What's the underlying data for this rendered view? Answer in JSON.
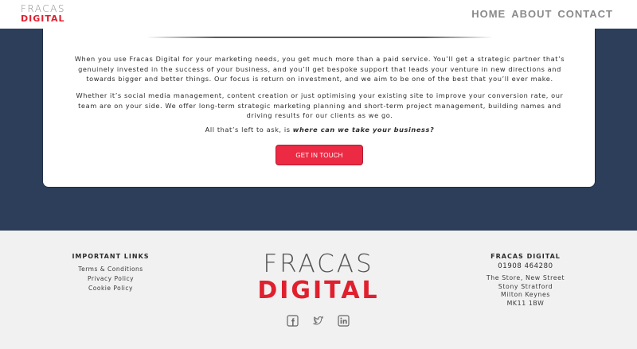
{
  "header": {
    "logo_top": "FRACAS",
    "logo_bottom": "DIGITAL",
    "nav": [
      "HOME",
      "ABOUT",
      "CONTACT"
    ]
  },
  "main": {
    "paragraph1": "When you use Fracas Digital for your marketing needs, you get much more than a paid service. You’ll get a strategic partner that’s genuinely invested in the success of your business, and you’ll get bespoke support that leads your venture in new directions and towards bigger and better things. Our focus is return on investment, and we aim to be one of the best that you’ll ever make.",
    "paragraph2": "Whether it’s social media management, content creation or just optimising your existing site to improve your conversion rate, our team are on your side. We offer long-term strategic marketing planning and short-term project management, building names and driving results for our clients as we go.",
    "closing_prefix": "All that’s left to ask, is ",
    "closing_emphasis": "where can we take your business?",
    "cta_label": "GET IN TOUCH"
  },
  "footer": {
    "links_title": "IMPORTANT LINKS",
    "links": [
      "Terms & Conditions",
      "Privacy Policy",
      "Cookie Policy"
    ],
    "logo_top": "FRACAS",
    "logo_bottom": "DIGITAL",
    "social_icons": [
      "facebook-icon",
      "twitter-icon",
      "linkedin-icon"
    ],
    "company_title": "FRACAS DIGITAL",
    "phone": "01908 464280",
    "address": [
      "The Store, New Street",
      "Stony Stratford",
      "Milton Keynes",
      "MK11 1BW"
    ]
  },
  "colors": {
    "navy": "#2c3e5a",
    "accent_red": "#ec2a44",
    "nav_grey": "#8a8a8a"
  }
}
